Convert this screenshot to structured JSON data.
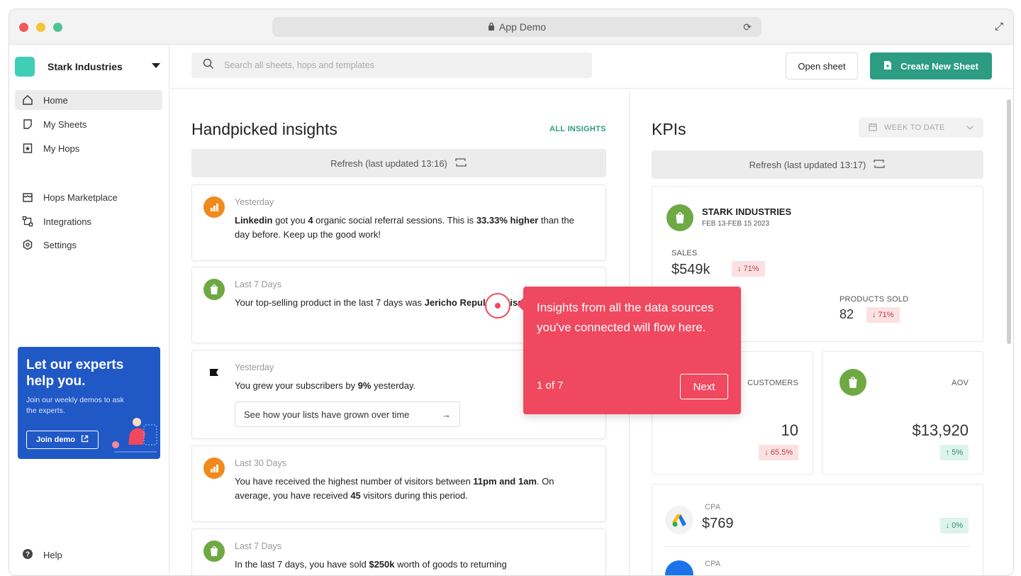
{
  "window": {
    "url_title": "App Demo",
    "colors": {
      "red": "#ef5b5b",
      "yellow": "#f4c534",
      "green": "#4ec292"
    }
  },
  "sidebar": {
    "org_name": "Stark Industries",
    "items": [
      {
        "label": "Home",
        "icon": "home-icon"
      },
      {
        "label": "My Sheets",
        "icon": "sheet-icon"
      },
      {
        "label": "My Hops",
        "icon": "hop-icon"
      },
      {
        "label": "Hops Marketplace",
        "icon": "marketplace-icon"
      },
      {
        "label": "Integrations",
        "icon": "integrations-icon"
      },
      {
        "label": "Settings",
        "icon": "settings-icon"
      }
    ],
    "promo": {
      "title": "Let our experts help you.",
      "subtitle": "Join our weekly demos to ask the experts.",
      "button": "Join demo"
    },
    "help_label": "Help"
  },
  "topbar": {
    "search_placeholder": "Search all sheets, hops and templates",
    "open_sheet": "Open sheet",
    "create_sheet": "Create New Sheet"
  },
  "insights": {
    "title": "Handpicked insights",
    "all_link": "ALL INSIGHTS",
    "refresh": "Refresh (last updated 13:16)",
    "cards": [
      {
        "when": "Yesterday",
        "icon": "analytics-icon",
        "text_parts": [
          "Linkedin",
          " got you ",
          "4",
          " organic social referral sessions. This is ",
          "33.33% higher",
          " than the day before. Keep up the good work!"
        ]
      },
      {
        "when": "Last 7 Days",
        "icon": "shopify-icon",
        "text_parts": [
          "Your top-selling product in the last 7 days was ",
          "Jericho Repulsor Missile X4530271",
          "."
        ]
      },
      {
        "when": "Yesterday",
        "icon": "mailchimp-icon",
        "text_parts": [
          "You grew your subscribers by ",
          "9%",
          " yesterday."
        ],
        "button": "See how your lists have grown over time"
      },
      {
        "when": "Last 30 Days",
        "icon": "analytics-icon",
        "text_parts": [
          "You have received the highest number of visitors between ",
          "11pm and 1am",
          ". On average, you have received ",
          "45",
          " visitors during this period."
        ]
      },
      {
        "when": "Last 7 Days",
        "icon": "shopify-icon",
        "text_parts": [
          "In the last 7 days, you have sold ",
          "$250k",
          " worth of goods to returning"
        ]
      }
    ]
  },
  "kpis": {
    "title": "KPIs",
    "range": "WEEK TO DATE",
    "refresh": "Refresh (last updated 13:17)",
    "store": {
      "name": "STARK INDUSTRIES",
      "dates": "FEB 13-FEB 15 2023"
    },
    "sales": {
      "label": "SALES",
      "value": "$549k",
      "change": "71%"
    },
    "products": {
      "label": "PRODUCTS SOLD",
      "value": "82",
      "change": "71%"
    },
    "customers": {
      "label": "CUSTOMERS",
      "value": "10",
      "change": "65.5%"
    },
    "aov": {
      "label": "AOV",
      "value": "$13,920",
      "change": "5%"
    },
    "cpa": {
      "label": "CPA",
      "value": "$769",
      "change": "0%"
    },
    "cpa2": {
      "label": "CPA"
    }
  },
  "tooltip": {
    "text": "Insights from all the data sources you've connected will flow here.",
    "count": "1 of 7",
    "next": "Next"
  }
}
